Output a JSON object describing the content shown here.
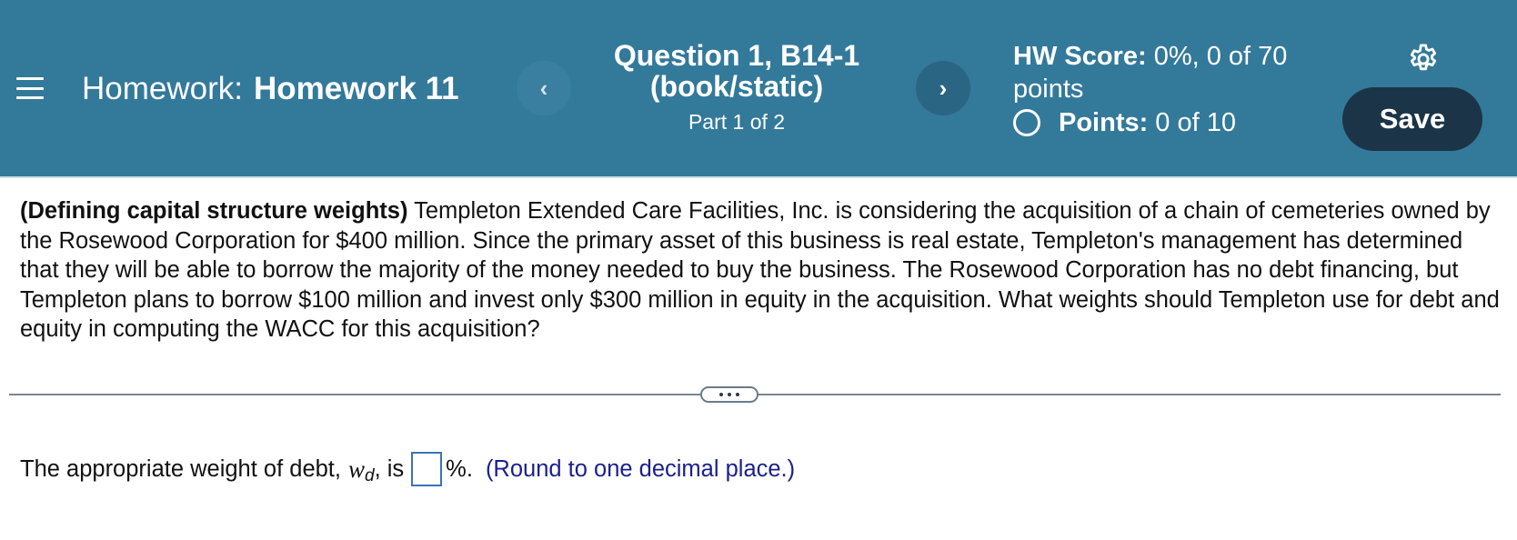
{
  "header": {
    "menu_icon": "hamburger-menu-icon",
    "homework_label": "Homework:",
    "homework_name": "Homework 11",
    "prev_glyph": "‹",
    "next_glyph": "›",
    "question_title": "Question 1, B14-1 (book/static)",
    "question_part": "Part 1 of 2",
    "hw_score_label": "HW Score:",
    "hw_score_value": "0%, 0 of 70 points",
    "points_label": "Points:",
    "points_value": "0 of 10",
    "settings_icon": "gear-icon",
    "save_label": "Save",
    "colors": {
      "header_bg": "#33799a",
      "save_bg": "#1c3448",
      "hint_text": "#1a1f8c"
    }
  },
  "question": {
    "bold_lead": "(Defining capital structure weights)",
    "body": "Templeton Extended Care Facilities, Inc. is considering the acquisition of a chain of cemeteries owned by the Rosewood Corporation for $400 million. Since the primary asset of this business is real estate, Templeton's management has determined that they will be able to borrow the majority of the money needed to buy the business. The Rosewood Corporation has no debt financing, but Templeton plans to borrow $100 million and invest only $300 million in equity in the acquisition. What weights should Templeton use for debt and equity in computing the WACC for this acquisition?"
  },
  "answer": {
    "prefix": "The appropriate weight of debt,",
    "variable": "w",
    "subscript": "d",
    "after_variable": ", is",
    "input_value": "",
    "suffix": "%.",
    "hint": "(Round to one decimal place.)"
  }
}
